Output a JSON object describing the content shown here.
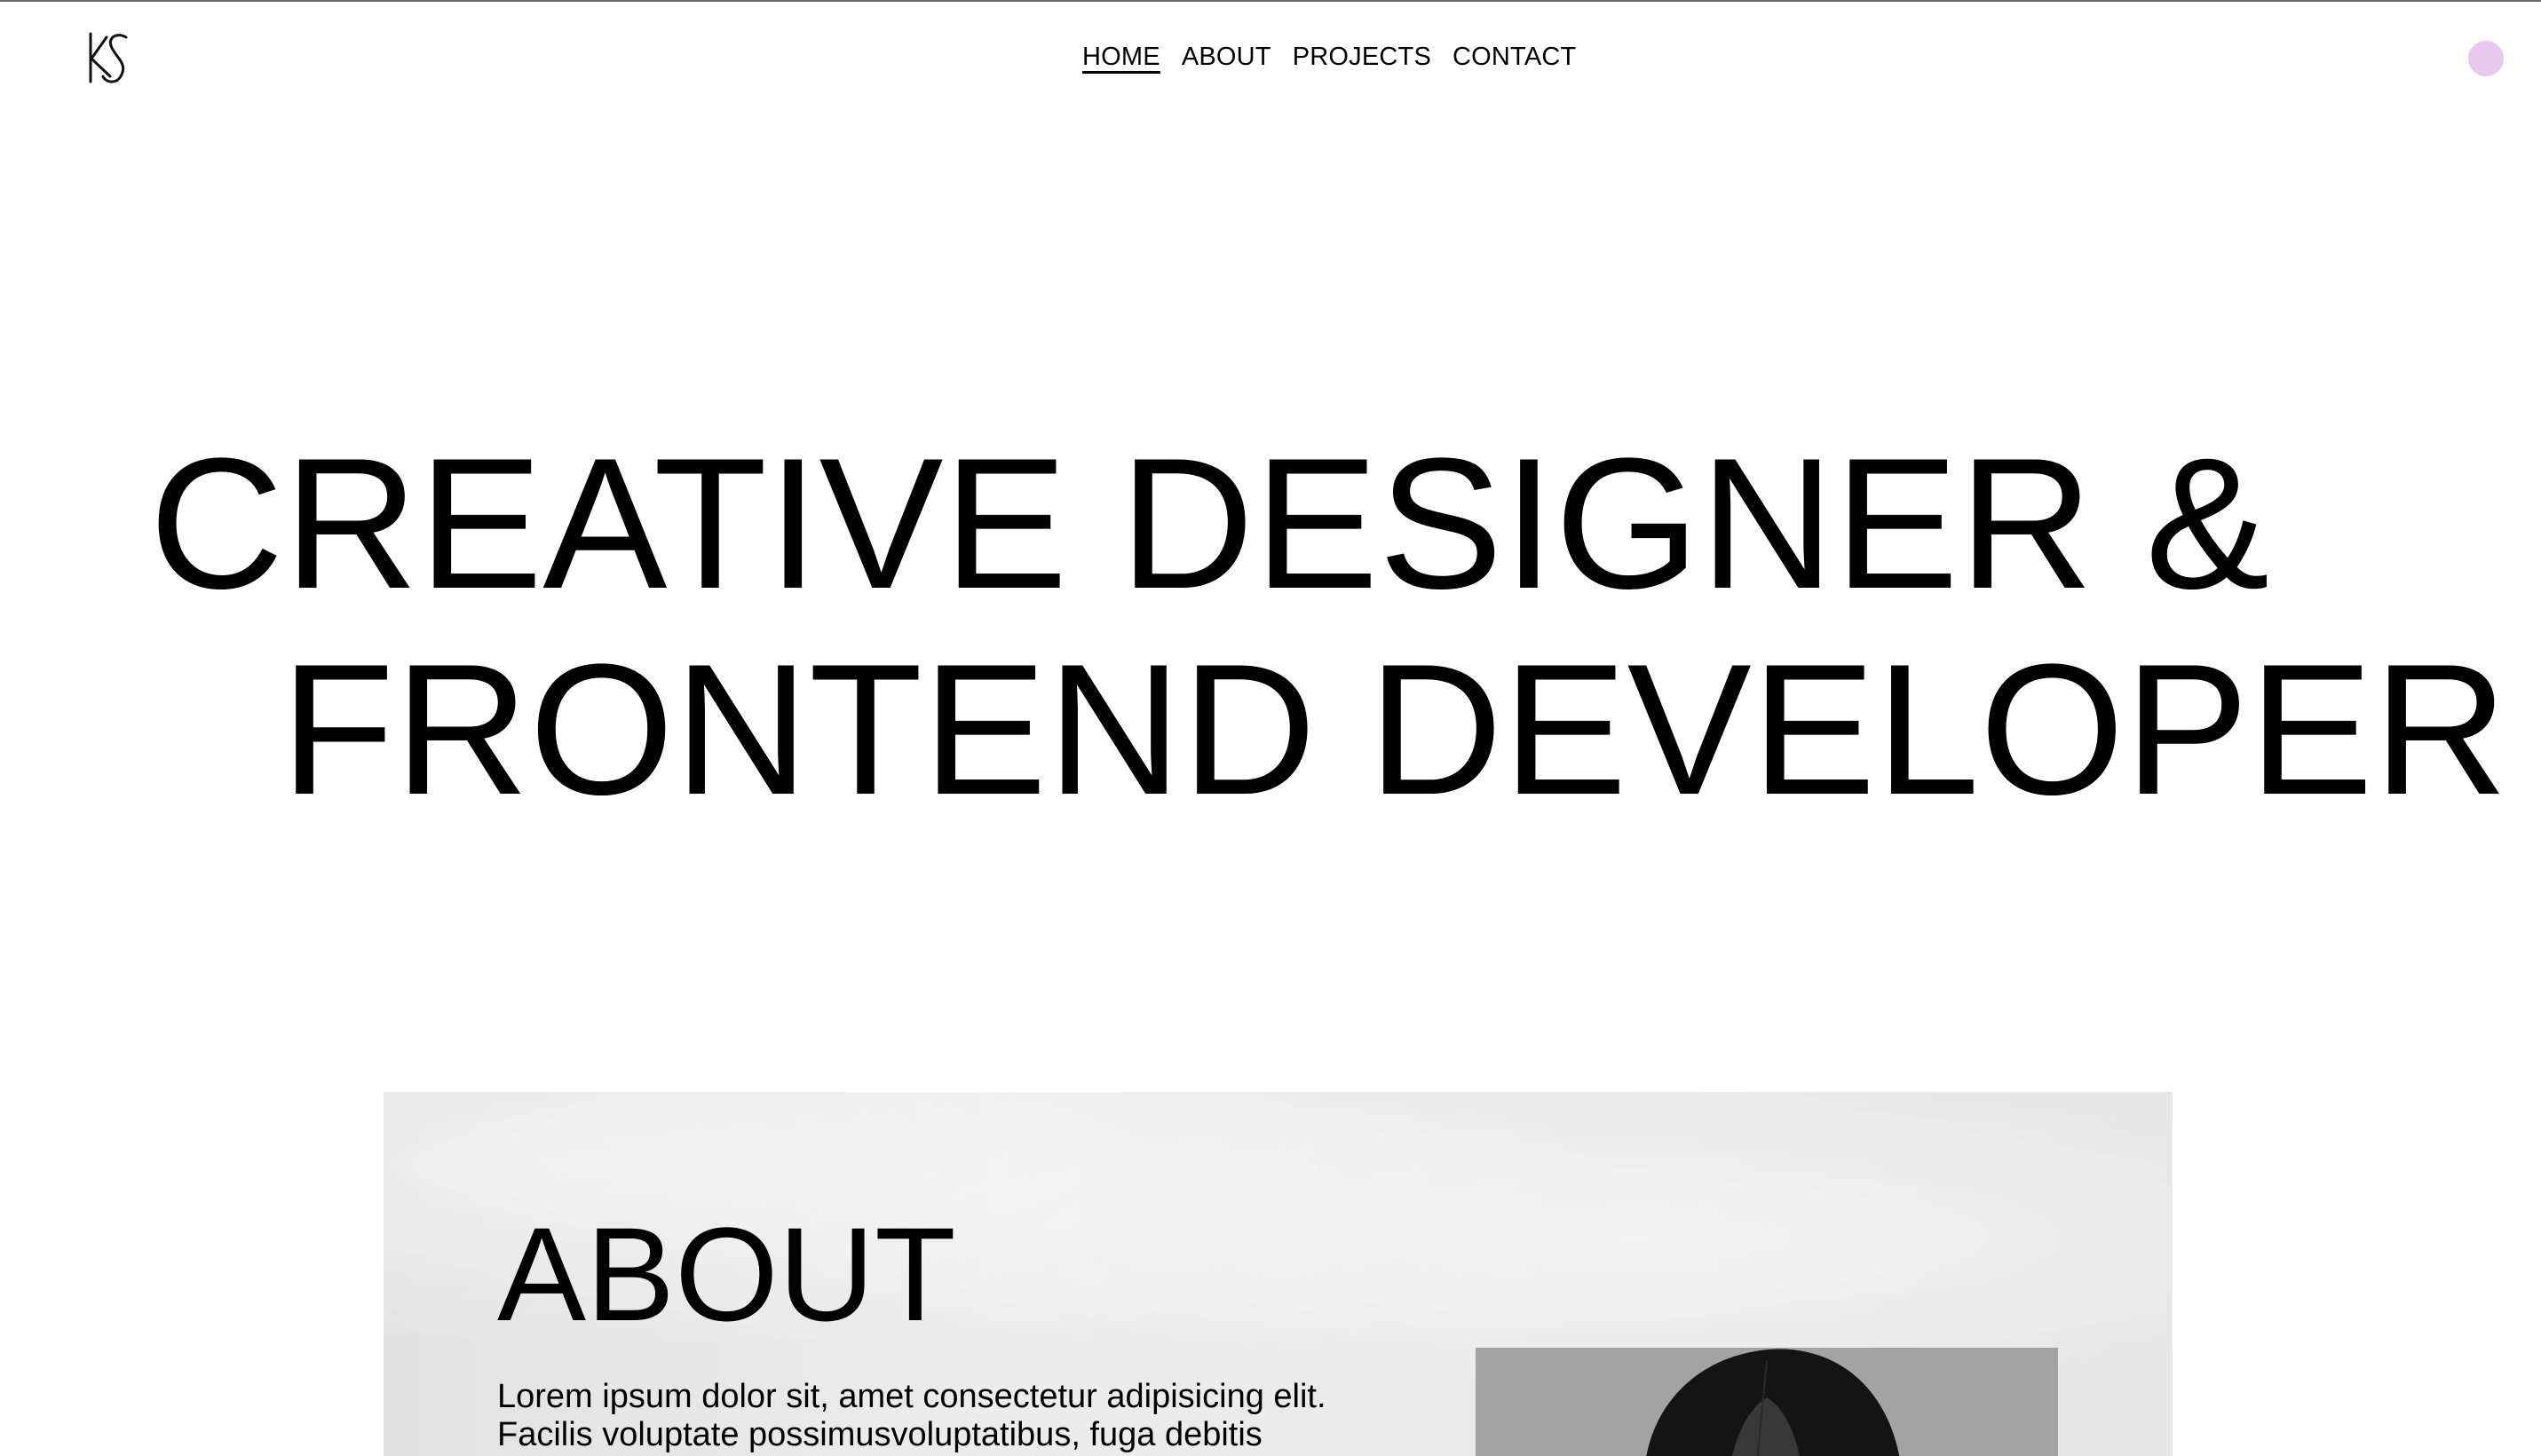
{
  "header": {
    "logo_text": "KS",
    "nav": [
      {
        "label": "HOME",
        "active": true
      },
      {
        "label": "ABOUT",
        "active": false
      },
      {
        "label": "PROJECTS",
        "active": false
      },
      {
        "label": "CONTACT",
        "active": false
      }
    ],
    "accent_dot_color": "#e7c9ef"
  },
  "hero": {
    "line1": "CREATIVE DESIGNER &",
    "line2": "FRONTEND DEVELOPER"
  },
  "about": {
    "title": "ABOUT",
    "text_line1": "Lorem ipsum dolor sit, amet consectetur adipisicing elit.",
    "text_line2": "Facilis voluptate possimusvoluptatibus, fuga debitis",
    "photo_icon": "portrait-photo"
  }
}
